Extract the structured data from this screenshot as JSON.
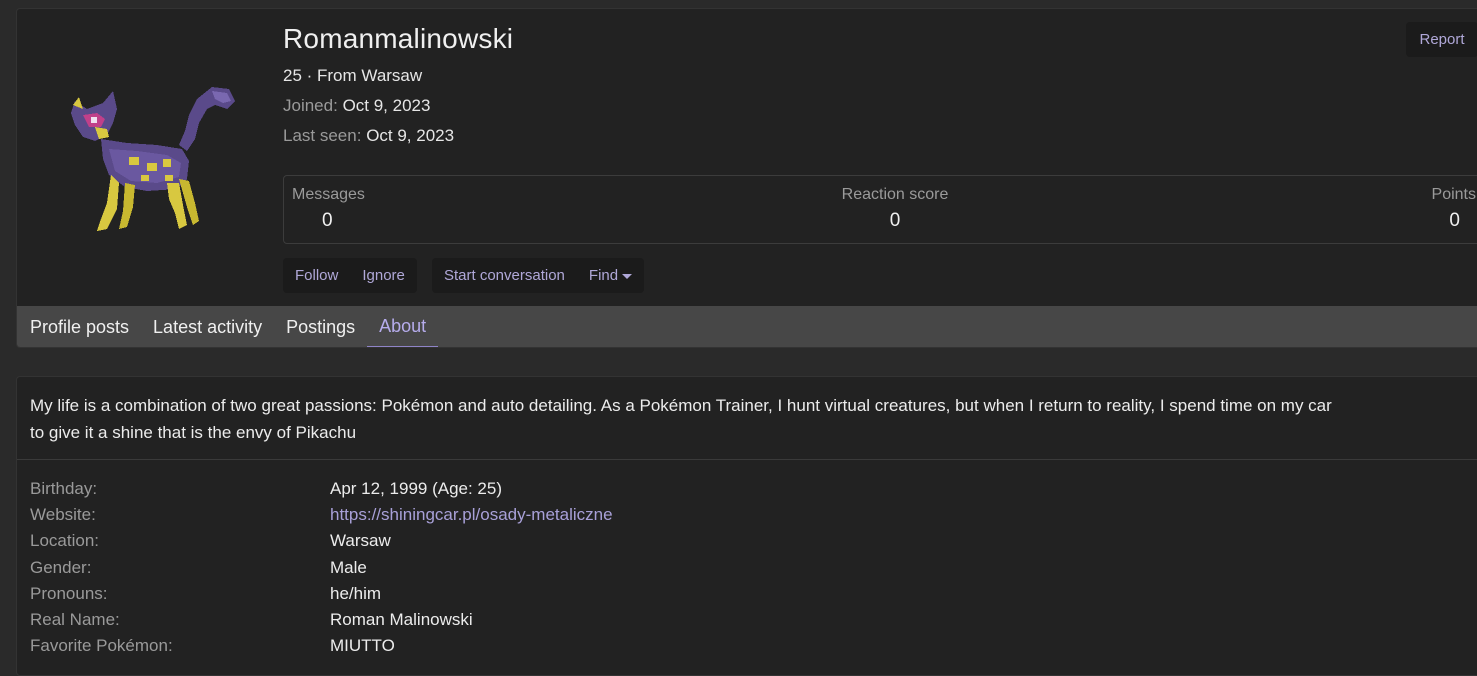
{
  "profile": {
    "username": "Romanmalinowski",
    "age_location": "25 · From Warsaw",
    "joined_label": "Joined:",
    "joined_value": "Oct 9, 2023",
    "last_seen_label": "Last seen:",
    "last_seen_value": "Oct 9, 2023",
    "report_label": "Report",
    "avatar_icon": "pokemon-sprite-purple-cat"
  },
  "stats": [
    {
      "label": "Messages",
      "value": "0"
    },
    {
      "label": "Reaction score",
      "value": "0"
    },
    {
      "label": "Points",
      "value": "0"
    }
  ],
  "actions": {
    "follow": "Follow",
    "ignore": "Ignore",
    "start_conversation": "Start conversation",
    "find": "Find"
  },
  "tabs": [
    {
      "label": "Profile posts",
      "active": false
    },
    {
      "label": "Latest activity",
      "active": false
    },
    {
      "label": "Postings",
      "active": false
    },
    {
      "label": "About",
      "active": true
    }
  ],
  "about": {
    "bio_line1": "My life is a combination of two great passions: Pokémon and auto detailing. As a Pokémon Trainer, I hunt virtual creatures, but when I return to reality, I spend time on my car",
    "bio_line2": "to give it a shine that is the envy of Pikachu",
    "fields": [
      {
        "label": "Birthday:",
        "value": "Apr 12, 1999 (Age: 25)"
      },
      {
        "label": "Website:",
        "value": "https://shiningcar.pl/osady-metaliczne"
      },
      {
        "label": "Location:",
        "value": "Warsaw"
      },
      {
        "label": "Gender:",
        "value": "Male"
      },
      {
        "label": "Pronouns:",
        "value": "he/him"
      },
      {
        "label": "Real Name:",
        "value": "Roman Malinowski"
      },
      {
        "label": "Favorite Pokémon:",
        "value": "MIUTTO"
      }
    ]
  },
  "colors": {
    "accent": "#b0a8d8",
    "tab_underline": "#8f84c8",
    "page_bg": "#2a2a2a",
    "card_bg": "#222222",
    "tabs_bg": "#474747"
  }
}
